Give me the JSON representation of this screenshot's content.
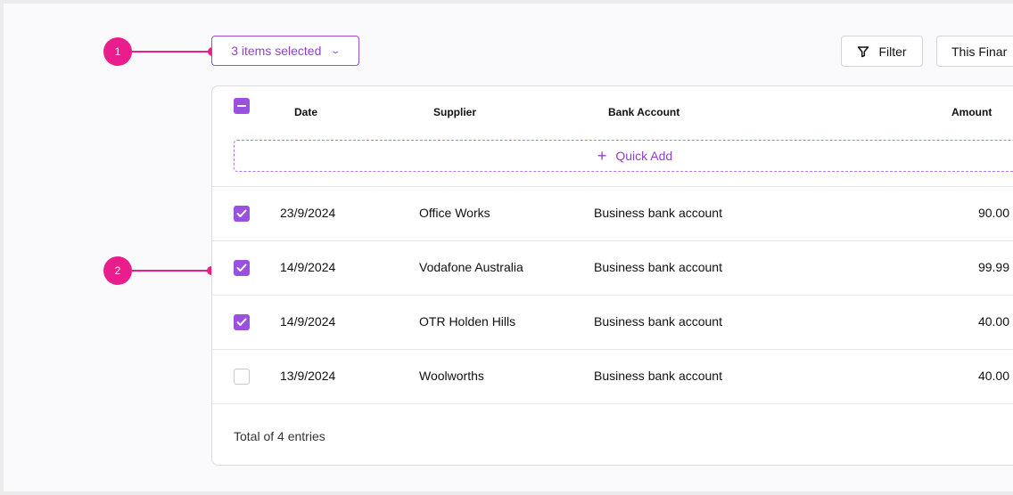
{
  "toolbar": {
    "selection_label": "3 items selected",
    "filter_label": "Filter",
    "period_label": "This Finar"
  },
  "table": {
    "headers": [
      "Date",
      "Supplier",
      "Bank Account",
      "Amount"
    ],
    "quick_add_label": "Quick Add",
    "rows": [
      {
        "checked": true,
        "date": "23/9/2024",
        "supplier": "Office Works",
        "account": "Business bank account",
        "amount": "90.00"
      },
      {
        "checked": true,
        "date": "14/9/2024",
        "supplier": "Vodafone Australia",
        "account": "Business bank account",
        "amount": "99.99"
      },
      {
        "checked": true,
        "date": "14/9/2024",
        "supplier": "OTR Holden Hills",
        "account": "Business bank account",
        "amount": "40.00"
      },
      {
        "checked": false,
        "date": "13/9/2024",
        "supplier": "Woolworths",
        "account": "Business bank account",
        "amount": "40.00"
      }
    ],
    "total_label": "Total of 4 entries"
  },
  "annotations": [
    "1",
    "2"
  ],
  "colors": {
    "accent": "#9b51e0",
    "marker": "#e91e8c"
  }
}
